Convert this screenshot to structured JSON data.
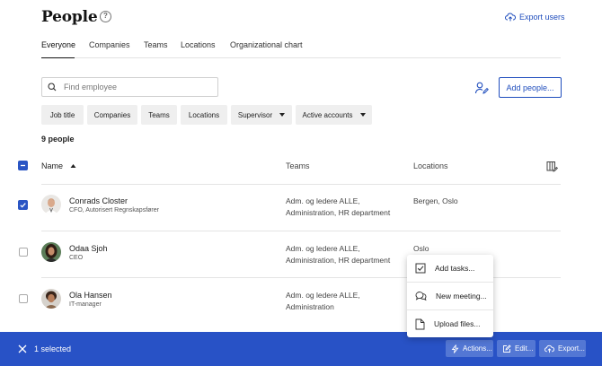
{
  "header": {
    "title": "People",
    "help_icon_glyph": "?",
    "export_label": "Export users"
  },
  "tabs": [
    {
      "label": "Everyone",
      "active": true
    },
    {
      "label": "Companies",
      "active": false
    },
    {
      "label": "Teams",
      "active": false
    },
    {
      "label": "Locations",
      "active": false
    },
    {
      "label": "Organizational chart",
      "active": false
    }
  ],
  "search": {
    "placeholder": "Find employee",
    "value": ""
  },
  "add_people_label": "Add people...",
  "filters": [
    {
      "label": "Job title",
      "dropdown": false
    },
    {
      "label": "Companies",
      "dropdown": false
    },
    {
      "label": "Teams",
      "dropdown": false
    },
    {
      "label": "Locations",
      "dropdown": false
    },
    {
      "label": "Supervisor",
      "dropdown": true
    },
    {
      "label": "Active accounts",
      "dropdown": true
    }
  ],
  "count_label": "9 people",
  "table": {
    "columns": {
      "name": "Name",
      "teams": "Teams",
      "locations": "Locations"
    },
    "sort": "ascending",
    "rows": [
      {
        "name": "Conrads Closter",
        "role": "CFO, Autorisert Regnskapsfører",
        "teams_line1": "Adm. og ledere ALLE,",
        "teams_line2": "Administration, HR department",
        "locations": "Bergen, Oslo",
        "checked": true
      },
      {
        "name": "Odaa Sjoh",
        "role": "CEO",
        "teams_line1": "Adm. og ledere ALLE,",
        "teams_line2": "Administration, HR department",
        "locations": "Oslo",
        "checked": false
      },
      {
        "name": "Ola Hansen",
        "role": "IT-manager",
        "teams_line1": "Adm. og ledere ALLE,",
        "teams_line2": "Administration",
        "locations": "",
        "checked": false
      }
    ]
  },
  "context_menu": {
    "items": [
      {
        "label": "Add tasks...",
        "icon": "checklist-icon"
      },
      {
        "label": "New meeting...",
        "icon": "chat-bubbles-icon"
      },
      {
        "label": "Upload files...",
        "icon": "document-icon"
      }
    ]
  },
  "bottom_bar": {
    "selected_label": "1 selected",
    "actions_label": "Actions...",
    "edit_label": "Edit...",
    "export_label": "Export..."
  },
  "colors": {
    "accent": "#1f4dbd",
    "bar": "#2852c6",
    "bar_button": "#5377d4"
  }
}
